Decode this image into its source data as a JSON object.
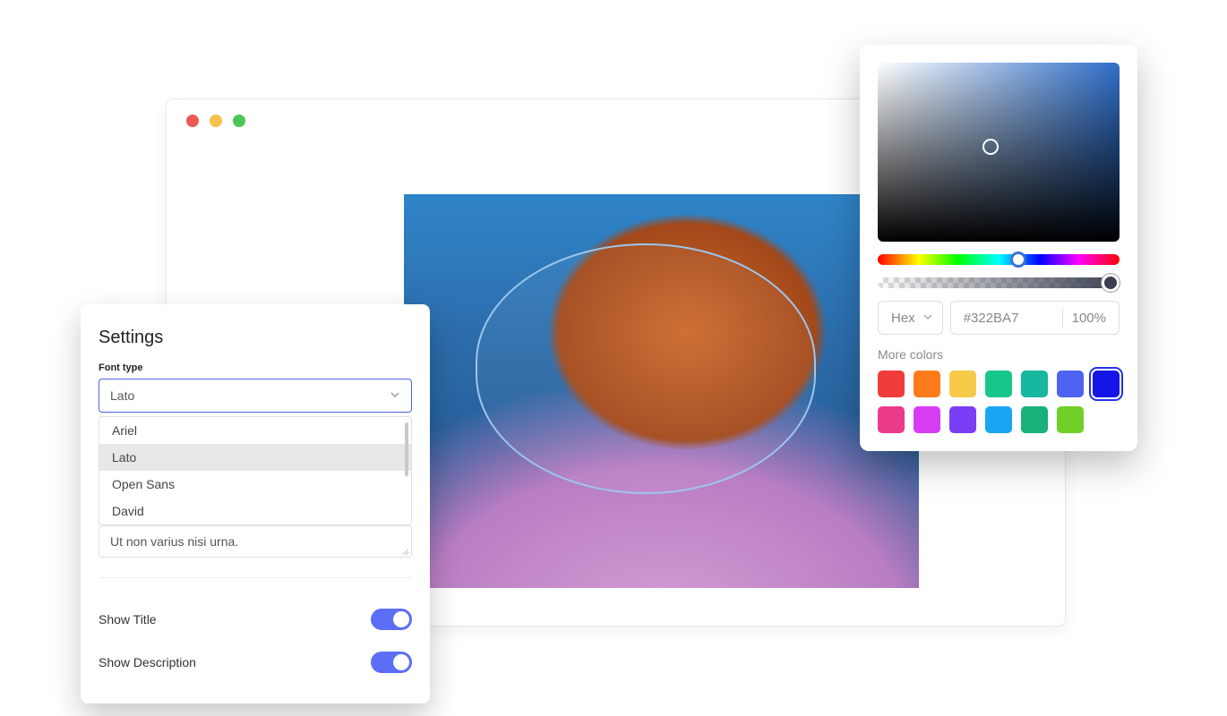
{
  "browser": {
    "traffic_lights": [
      "red",
      "yellow",
      "green"
    ]
  },
  "canvas": {
    "image_description": "Monarch butterfly on pink flowers with blue background",
    "focus_shape": "oval"
  },
  "settings": {
    "title": "Settings",
    "font_type": {
      "label": "Font type",
      "value": "Lato",
      "options": [
        "Ariel",
        "Lato",
        "Open Sans",
        "David"
      ],
      "selected_index": 1
    },
    "sample_text": "Ut non varius nisi urna.",
    "show_title": {
      "label": "Show Title",
      "on": true
    },
    "show_description": {
      "label": "Show Description",
      "on": true
    }
  },
  "color_picker": {
    "format_label": "Hex",
    "hex_value": "#322BA7",
    "opacity_label": "100%",
    "hue_position_pct": 58,
    "alpha_position_pct": 100,
    "more_colors_label": "More colors",
    "swatches_row1": [
      "#f13c3c",
      "#ff7a1a",
      "#f7c948",
      "#17c78a",
      "#17b7a0",
      "#4e63f2",
      "#1516e6"
    ],
    "swatches_row2": [
      "#ec3a8b",
      "#d63df2",
      "#7a3ff5",
      "#18a6f2",
      "#18b17a",
      "#6fd128"
    ],
    "selected_swatch": "#1516e6"
  }
}
